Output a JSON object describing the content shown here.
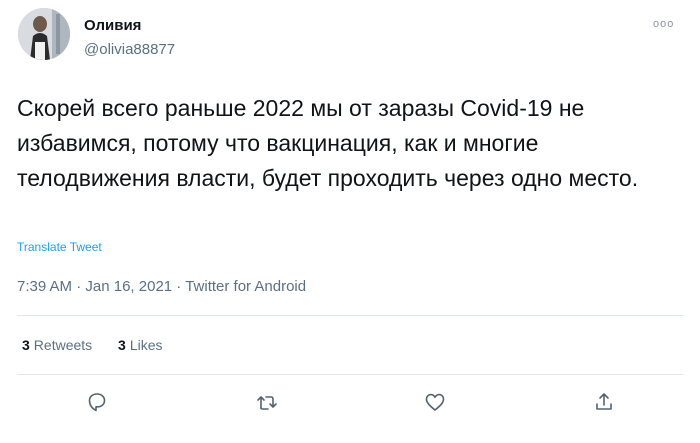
{
  "author": {
    "name": "Оливия",
    "handle": "@olivia88877"
  },
  "more_label": "ooo",
  "tweet": {
    "text": "Скорей всего раньше 2022 мы от заразы Covid-19 не избавимся, потому что вакцинация, как и многие телодвижения  власти, будет проходить через одно место.",
    "translate_label": "Translate Tweet"
  },
  "meta": {
    "time": "7:39 AM",
    "date": "Jan 16, 2021",
    "source": "Twitter for Android",
    "separator": " · "
  },
  "stats": {
    "retweets_count": "3",
    "retweets_label": "Retweets",
    "likes_count": "3",
    "likes_label": "Likes"
  },
  "colors": {
    "text": "#0f1419",
    "secondary": "#5b7083",
    "link": "#1da1f2",
    "icon": "#536471",
    "divider": "#e1e8ed"
  },
  "icons": {
    "reply": "reply-icon",
    "retweet": "retweet-icon",
    "like": "heart-icon",
    "share": "share-icon"
  }
}
